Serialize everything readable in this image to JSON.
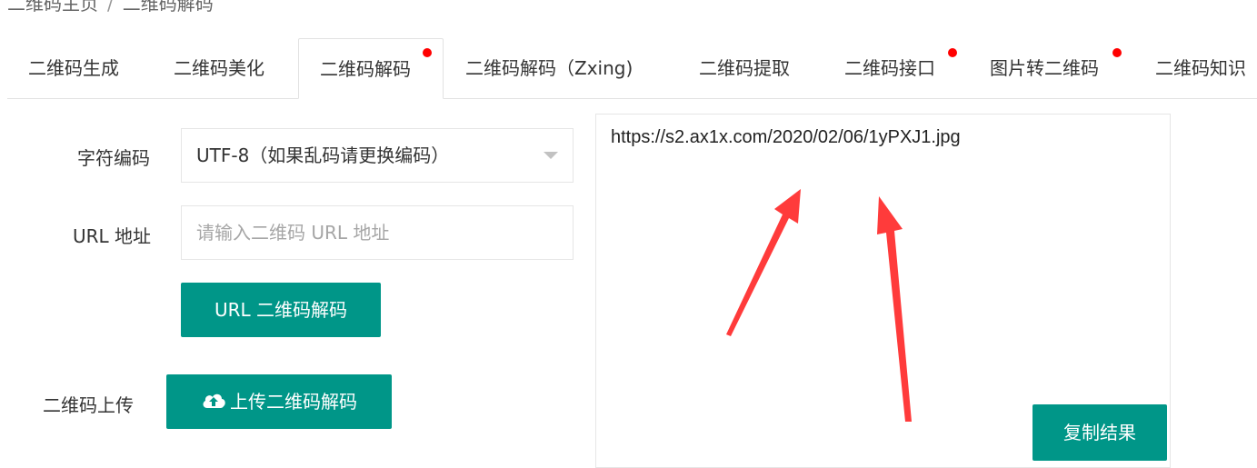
{
  "breadcrumb": {
    "home": "二维码主页",
    "separator": "/",
    "current": "二维码解码"
  },
  "tabs": [
    {
      "label": "二维码生成",
      "badge": false
    },
    {
      "label": "二维码美化",
      "badge": false
    },
    {
      "label": "二维码解码",
      "badge": true,
      "active": true
    },
    {
      "label": "二维码解码（Zxing)",
      "badge": false
    },
    {
      "label": "二维码提取",
      "badge": false
    },
    {
      "label": "二维码接口",
      "badge": true
    },
    {
      "label": "图片转二维码",
      "badge": true
    },
    {
      "label": "二维码知识",
      "badge": false
    }
  ],
  "form": {
    "charset_label": "字符编码",
    "charset_value": "UTF-8（如果乱码请更换编码）",
    "url_label": "URL 地址",
    "url_placeholder": "请输入二维码 URL 地址",
    "url_decode_button": "URL 二维码解码",
    "upload_label": "二维码上传",
    "upload_button": "上传二维码解码",
    "upload_icon": "cloud-upload-icon"
  },
  "result": {
    "text": "https://s2.ax1x.com/2020/02/06/1yPXJ1.jpg",
    "copy_button": "复制结果"
  },
  "colors": {
    "primary": "#009688",
    "badge": "#ff0000",
    "arrow": "#ff3b3b"
  }
}
